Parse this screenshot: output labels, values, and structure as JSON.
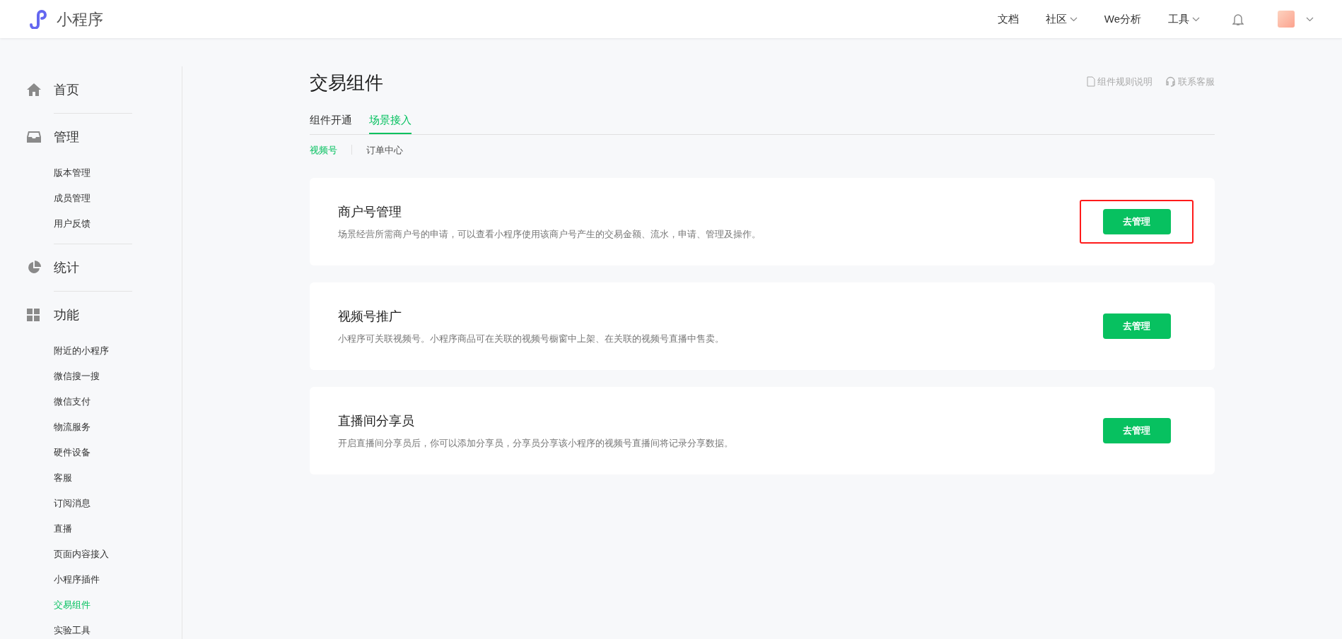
{
  "header": {
    "logo_text": "小程序",
    "nav": [
      {
        "label": "文档",
        "dropdown": false
      },
      {
        "label": "社区",
        "dropdown": true
      },
      {
        "label": "We分析",
        "dropdown": false
      },
      {
        "label": "工具",
        "dropdown": true
      }
    ]
  },
  "sidebar": {
    "groups": [
      {
        "label": "首页",
        "kind": "home"
      },
      {
        "label": "管理",
        "kind": "inbox",
        "items": [
          {
            "label": "版本管理",
            "selected": false
          },
          {
            "label": "成员管理",
            "selected": false
          },
          {
            "label": "用户反馈",
            "selected": false
          }
        ]
      },
      {
        "label": "统计",
        "kind": "pie"
      },
      {
        "label": "功能",
        "kind": "grid",
        "items": [
          {
            "label": "附近的小程序",
            "selected": false
          },
          {
            "label": "微信搜一搜",
            "selected": false
          },
          {
            "label": "微信支付",
            "selected": false
          },
          {
            "label": "物流服务",
            "selected": false
          },
          {
            "label": "硬件设备",
            "selected": false
          },
          {
            "label": "客服",
            "selected": false
          },
          {
            "label": "订阅消息",
            "selected": false
          },
          {
            "label": "直播",
            "selected": false
          },
          {
            "label": "页面内容接入",
            "selected": false
          },
          {
            "label": "小程序插件",
            "selected": false
          },
          {
            "label": "交易组件",
            "selected": true
          },
          {
            "label": "实验工具",
            "selected": false
          }
        ]
      }
    ]
  },
  "page": {
    "title": "交易组件",
    "links": [
      {
        "label": "组件规则说明",
        "kind": "document"
      },
      {
        "label": "联系客服",
        "kind": "headset"
      }
    ],
    "tabs": [
      {
        "label": "组件开通",
        "selected": false
      },
      {
        "label": "场景接入",
        "selected": true
      }
    ],
    "subtabs": [
      {
        "label": "视频号",
        "selected": true
      },
      {
        "label": "订单中心",
        "selected": false
      }
    ],
    "cards": [
      {
        "title": "商户号管理",
        "description": "场景经营所需商户号的申请，可以查看小程序使用该商户号产生的交易金额、流水，申请、管理及操作。",
        "button": "去管理",
        "highlighted": true
      },
      {
        "title": "视频号推广",
        "description": "小程序可关联视频号。小程序商品可在关联的视频号橱窗中上架、在关联的视频号直播中售卖。",
        "button": "去管理",
        "highlighted": false
      },
      {
        "title": "直播间分享员",
        "description": "开启直播间分享员后，你可以添加分享员，分享员分享该小程序的视频号直播间将记录分享数据。",
        "button": "去管理",
        "highlighted": false
      }
    ]
  }
}
